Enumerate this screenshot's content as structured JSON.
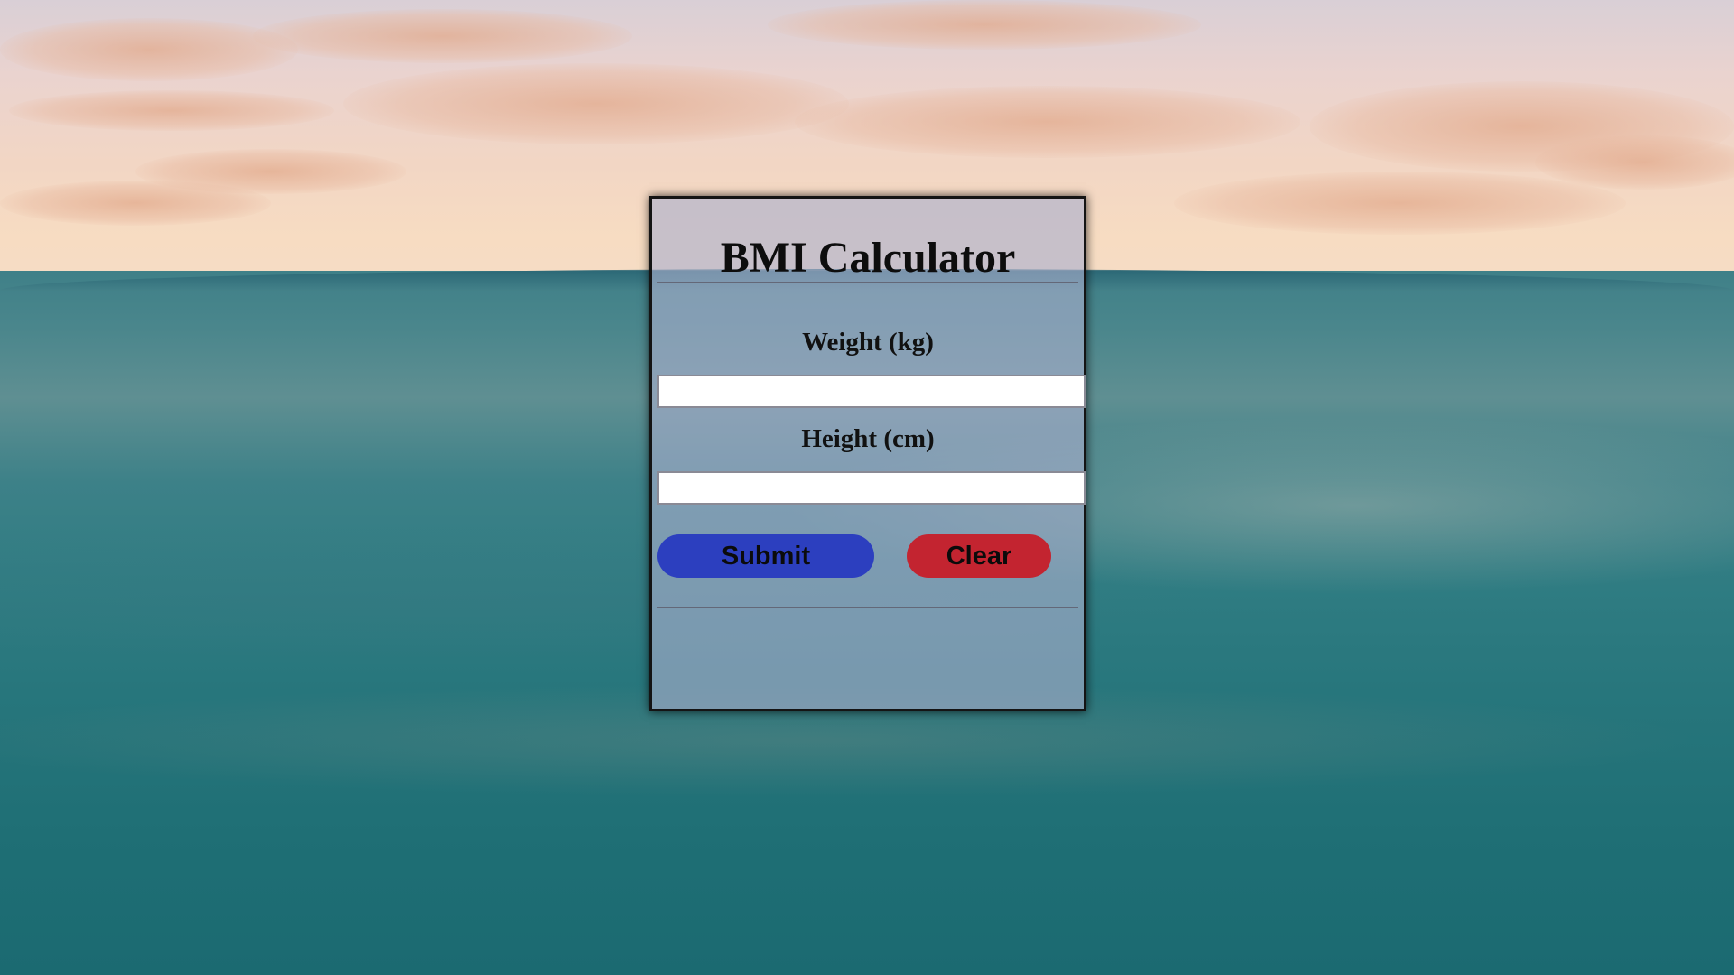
{
  "calculator": {
    "title": "BMI Calculator",
    "weight_label": "Weight (kg)",
    "weight_value": "",
    "height_label": "Height (cm)",
    "height_value": "",
    "submit_label": "Submit",
    "clear_label": "Clear",
    "result_text": ""
  },
  "colors": {
    "submit_button": "#2c3fbf",
    "clear_button": "#c32430",
    "panel_border": "#141414"
  }
}
